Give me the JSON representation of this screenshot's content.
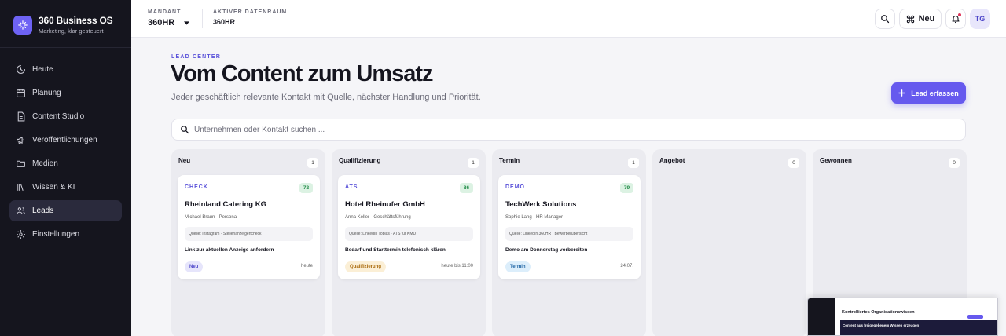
{
  "brand": {
    "name": "360 Business OS",
    "tagline": "Marketing, klar gesteuert"
  },
  "nav": [
    {
      "label": "Heute",
      "icon": "activity-icon"
    },
    {
      "label": "Planung",
      "icon": "calendar-icon"
    },
    {
      "label": "Content Studio",
      "icon": "document-icon"
    },
    {
      "label": "Veröffentlichungen",
      "icon": "megaphone-icon"
    },
    {
      "label": "Medien",
      "icon": "folder-icon"
    },
    {
      "label": "Wissen & KI",
      "icon": "library-icon"
    },
    {
      "label": "Leads",
      "icon": "users-icon",
      "active": true
    },
    {
      "label": "Einstellungen",
      "icon": "gear-icon"
    }
  ],
  "topbar": {
    "mandant_label": "MANDANT",
    "mandant_value": "360HR",
    "datenraum_label": "AKTIVER DATENRAUM",
    "datenraum_value": "360HR",
    "new_label": "Neu",
    "avatar_initials": "TG"
  },
  "page": {
    "eyebrow": "LEAD CENTER",
    "title": "Vom Content zum Umsatz",
    "subtitle": "Jeder geschäftlich relevante Kontakt mit Quelle, nächster Handlung und Priorität.",
    "primary_button": "Lead erfassen",
    "search_placeholder": "Unternehmen oder Kontakt suchen ..."
  },
  "columns": [
    {
      "title": "Neu",
      "count": "1",
      "cards": [
        {
          "tag": "CHECK",
          "score": "72",
          "company": "Rheinland Catering KG",
          "contact": "Michael Braun · Personal",
          "source": "Quelle: Instagram · Stellenanzeigencheck",
          "action": "Link zur aktuellen Anzeige anfordern",
          "stage": "Neu",
          "stage_class": "neu",
          "due": "heute"
        }
      ]
    },
    {
      "title": "Qualifizierung",
      "count": "1",
      "cards": [
        {
          "tag": "ATS",
          "score": "86",
          "company": "Hotel Rheinufer GmbH",
          "contact": "Anna Keller · Geschäftsführung",
          "source": "Quelle: LinkedIn Tobias · ATS für KMU",
          "action": "Bedarf und Starttermin telefonisch klären",
          "stage": "Qualifizierung",
          "stage_class": "qual",
          "due": "heute bis 11:00"
        }
      ]
    },
    {
      "title": "Termin",
      "count": "1",
      "cards": [
        {
          "tag": "DEMO",
          "score": "79",
          "company": "TechWerk Solutions",
          "contact": "Sophie Lang · HR Manager",
          "source": "Quelle: LinkedIn 360HR · Bewerberübersicht",
          "action": "Demo am Donnerstag vorbereiten",
          "stage": "Termin",
          "stage_class": "term",
          "due": "24.07."
        }
      ]
    },
    {
      "title": "Angebot",
      "count": "0",
      "cards": []
    },
    {
      "title": "Gewonnen",
      "count": "0",
      "cards": []
    }
  ],
  "preview": {
    "title": "Kontrolliertes Organisationswissen",
    "hero_text": "Content aus freigegebenem Wissen erzeugen"
  },
  "colors": {
    "accent": "#6659ee",
    "sidebar": "#15151e",
    "background": "#f5f5f8"
  }
}
